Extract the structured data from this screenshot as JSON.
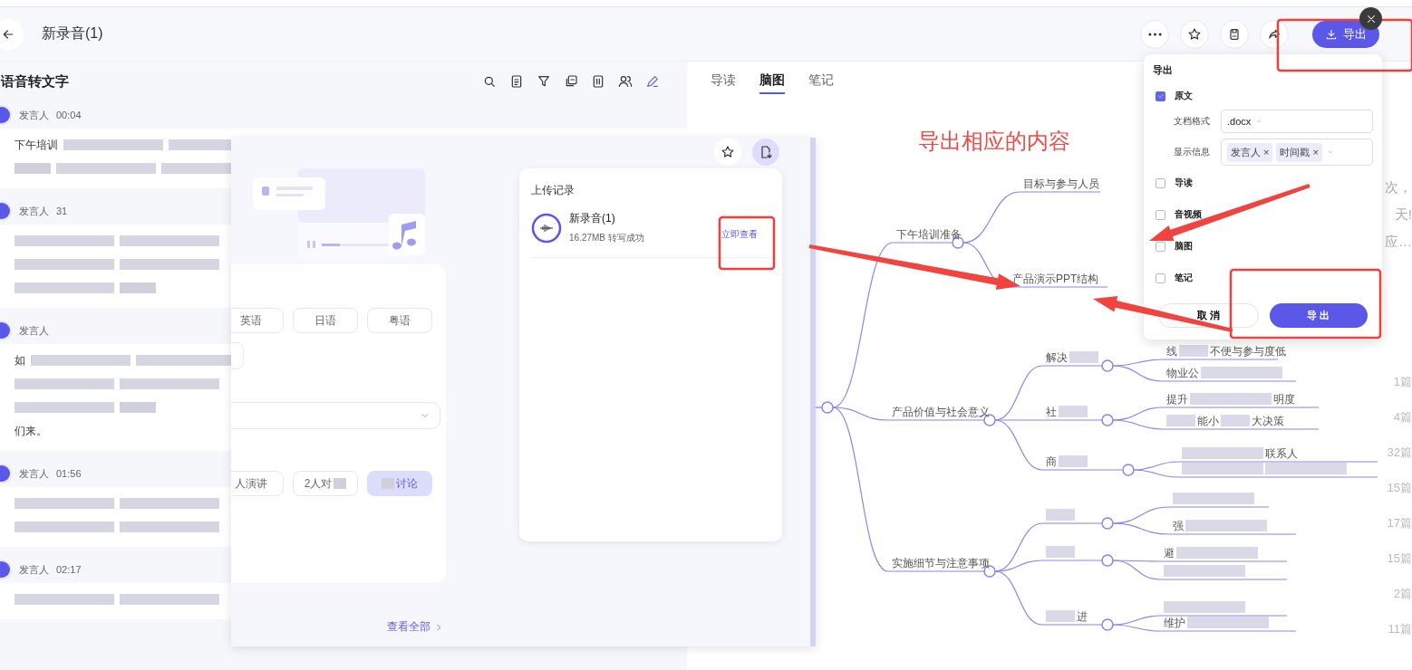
{
  "header": {
    "title": "新录音(1)",
    "export_button": "导出"
  },
  "transcript": {
    "title": "语音转文字",
    "entries": [
      {
        "speaker": "发言人",
        "time": "00:04",
        "lines": [
          [
            {
              "kind": "text",
              "text": "下午培训"
            },
            {
              "kind": "longmask"
            },
            {
              "kind": "longmask"
            }
          ],
          [
            {
              "kind": "mask"
            },
            {
              "kind": "longmask"
            },
            {
              "kind": "longmask"
            }
          ]
        ]
      },
      {
        "speaker": "发言人",
        "time": "31",
        "lines": [
          [
            {
              "kind": "longmask"
            },
            {
              "kind": "longmask"
            }
          ],
          [
            {
              "kind": "longmask"
            },
            {
              "kind": "longmask"
            }
          ],
          [
            {
              "kind": "longmask"
            },
            {
              "kind": "mask"
            }
          ]
        ]
      },
      {
        "speaker": "发言人",
        "lines": [
          [
            {
              "kind": "text",
              "text": "如"
            },
            {
              "kind": "longmask"
            },
            {
              "kind": "longmask"
            }
          ],
          [
            {
              "kind": "longmask"
            },
            {
              "kind": "longmask"
            }
          ],
          [
            {
              "kind": "longmask"
            },
            {
              "kind": "mask"
            }
          ],
          [
            {
              "kind": "text",
              "text": "们来。"
            }
          ]
        ]
      },
      {
        "speaker": "发言人",
        "time": "01:56",
        "lines": [
          [
            {
              "kind": "longmask"
            },
            {
              "kind": "longmask"
            }
          ],
          [
            {
              "kind": "longmask"
            },
            {
              "kind": "longmask"
            }
          ]
        ]
      },
      {
        "speaker": "发言人",
        "time": "02:17",
        "lines": [
          [
            {
              "kind": "longmask"
            },
            {
              "kind": "longmask"
            }
          ]
        ]
      }
    ]
  },
  "upload_dialog": {
    "language_chips": [
      {
        "segments": [
          {
            "kind": "text",
            "text": "英语"
          }
        ],
        "selected": false
      },
      {
        "segments": [
          {
            "kind": "text",
            "text": "日语"
          }
        ],
        "selected": false
      },
      {
        "segments": [
          {
            "kind": "text",
            "text": "粤语"
          }
        ],
        "selected": false
      }
    ],
    "scene_chips": [
      {
        "segments": [
          {
            "kind": "text",
            "text": "人演讲"
          }
        ],
        "selected": false
      },
      {
        "segments": [
          {
            "kind": "text",
            "text": "2人对"
          },
          {
            "kind": "mask"
          }
        ],
        "selected": false
      },
      {
        "segments": [
          {
            "kind": "mask"
          },
          {
            "kind": "text",
            "text": "讨论"
          }
        ],
        "selected": true
      }
    ],
    "view_all": "查看全部",
    "records": {
      "title": "上传记录",
      "items": [
        {
          "name": "新录音(1)",
          "detail": "16.27MB 转写成功",
          "action": "立即查看"
        }
      ]
    }
  },
  "right_panel": {
    "tabs": [
      {
        "label": "导读",
        "selected": false
      },
      {
        "label": "脑图",
        "selected": true
      },
      {
        "label": "笔记",
        "selected": false
      }
    ],
    "mindmap": {
      "children": [
        {
          "segments": [
            {
              "kind": "text",
              "text": "下午培训准备"
            }
          ],
          "children": [
            {
              "segments": [
                {
                  "kind": "text",
                  "text": "目标与参与人员"
                }
              ]
            },
            {
              "segments": [
                {
                  "kind": "text",
                  "text": "产品演示PPT结构"
                }
              ]
            }
          ]
        },
        {
          "segments": [
            {
              "kind": "text",
              "text": "产品价值与社会意义"
            }
          ],
          "children": [
            {
              "segments": [
                {
                  "kind": "text",
                  "text": "解决"
                },
                {
                  "kind": "mask"
                }
              ],
              "children": [
                {
                  "segments": [
                    {
                      "kind": "text",
                      "text": "线"
                    },
                    {
                      "kind": "mask"
                    },
                    {
                      "kind": "text",
                      "text": "不便与参与度低"
                    }
                  ]
                },
                {
                  "segments": [
                    {
                      "kind": "text",
                      "text": "物业公"
                    },
                    {
                      "kind": "longmask"
                    }
                  ]
                }
              ]
            },
            {
              "segments": [
                {
                  "kind": "text",
                  "text": "社"
                },
                {
                  "kind": "mask"
                }
              ],
              "children": [
                {
                  "segments": [
                    {
                      "kind": "text",
                      "text": "提升"
                    },
                    {
                      "kind": "longmask"
                    },
                    {
                      "kind": "text",
                      "text": "明度"
                    }
                  ]
                },
                {
                  "segments": [
                    {
                      "kind": "mask"
                    },
                    {
                      "kind": "text",
                      "text": "能小"
                    },
                    {
                      "kind": "mask"
                    },
                    {
                      "kind": "text",
                      "text": "大决策"
                    }
                  ]
                }
              ]
            },
            {
              "segments": [
                {
                  "kind": "text",
                  "text": "商"
                },
                {
                  "kind": "mask"
                }
              ],
              "children": [
                {
                  "segments": [
                    {
                      "kind": "longmask"
                    },
                    {
                      "kind": "text",
                      "text": "联系人"
                    }
                  ]
                },
                {
                  "segments": [
                    {
                      "kind": "longmask"
                    },
                    {
                      "kind": "longmask"
                    }
                  ]
                }
              ]
            }
          ]
        },
        {
          "segments": [
            {
              "kind": "text",
              "text": "实施细节与注意事项"
            }
          ],
          "children": [
            {
              "segments": [
                {
                  "kind": "mask"
                }
              ],
              "children": [
                {
                  "segments": [
                    {
                      "kind": "longmask"
                    }
                  ]
                },
                {
                  "segments": [
                    {
                      "kind": "text",
                      "text": "强"
                    },
                    {
                      "kind": "longmask"
                    }
                  ]
                }
              ]
            },
            {
              "segments": [
                {
                  "kind": "mask"
                }
              ],
              "children": [
                {
                  "segments": [
                    {
                      "kind": "text",
                      "text": "避"
                    },
                    {
                      "kind": "longmask"
                    }
                  ]
                },
                {
                  "segments": [
                    {
                      "kind": "longmask"
                    }
                  ]
                }
              ]
            },
            {
              "segments": [
                {
                  "kind": "mask"
                },
                {
                  "kind": "text",
                  "text": "进"
                }
              ],
              "children": [
                {
                  "segments": [
                    {
                      "kind": "longmask"
                    }
                  ]
                },
                {
                  "segments": [
                    {
                      "kind": "text",
                      "text": "维护"
                    },
                    {
                      "kind": "longmask"
                    }
                  ]
                }
              ]
            }
          ]
        }
      ]
    },
    "behind_fragments": [
      "次，",
      "天!",
      "应…"
    ],
    "behind_counts": [
      "1篇",
      "4篇",
      "32篇",
      "15篇",
      "17篇",
      "15篇",
      "2篇",
      "11篇"
    ]
  },
  "export_popover": {
    "title": "导出",
    "options": [
      {
        "label": "原文",
        "checked": true,
        "fields": [
          {
            "label": "文档格式",
            "value": ".docx"
          },
          {
            "label": "显示信息",
            "tags": [
              "发言人 ×",
              "时间戳 ×"
            ]
          }
        ]
      },
      {
        "label": "导读",
        "checked": false
      },
      {
        "label": "音视频",
        "checked": false
      },
      {
        "label": "脑图",
        "checked": false
      },
      {
        "label": "笔记",
        "checked": false
      }
    ],
    "cancel": "取 消",
    "confirm": "导 出"
  },
  "annotation": {
    "note": "导出相应的内容"
  }
}
